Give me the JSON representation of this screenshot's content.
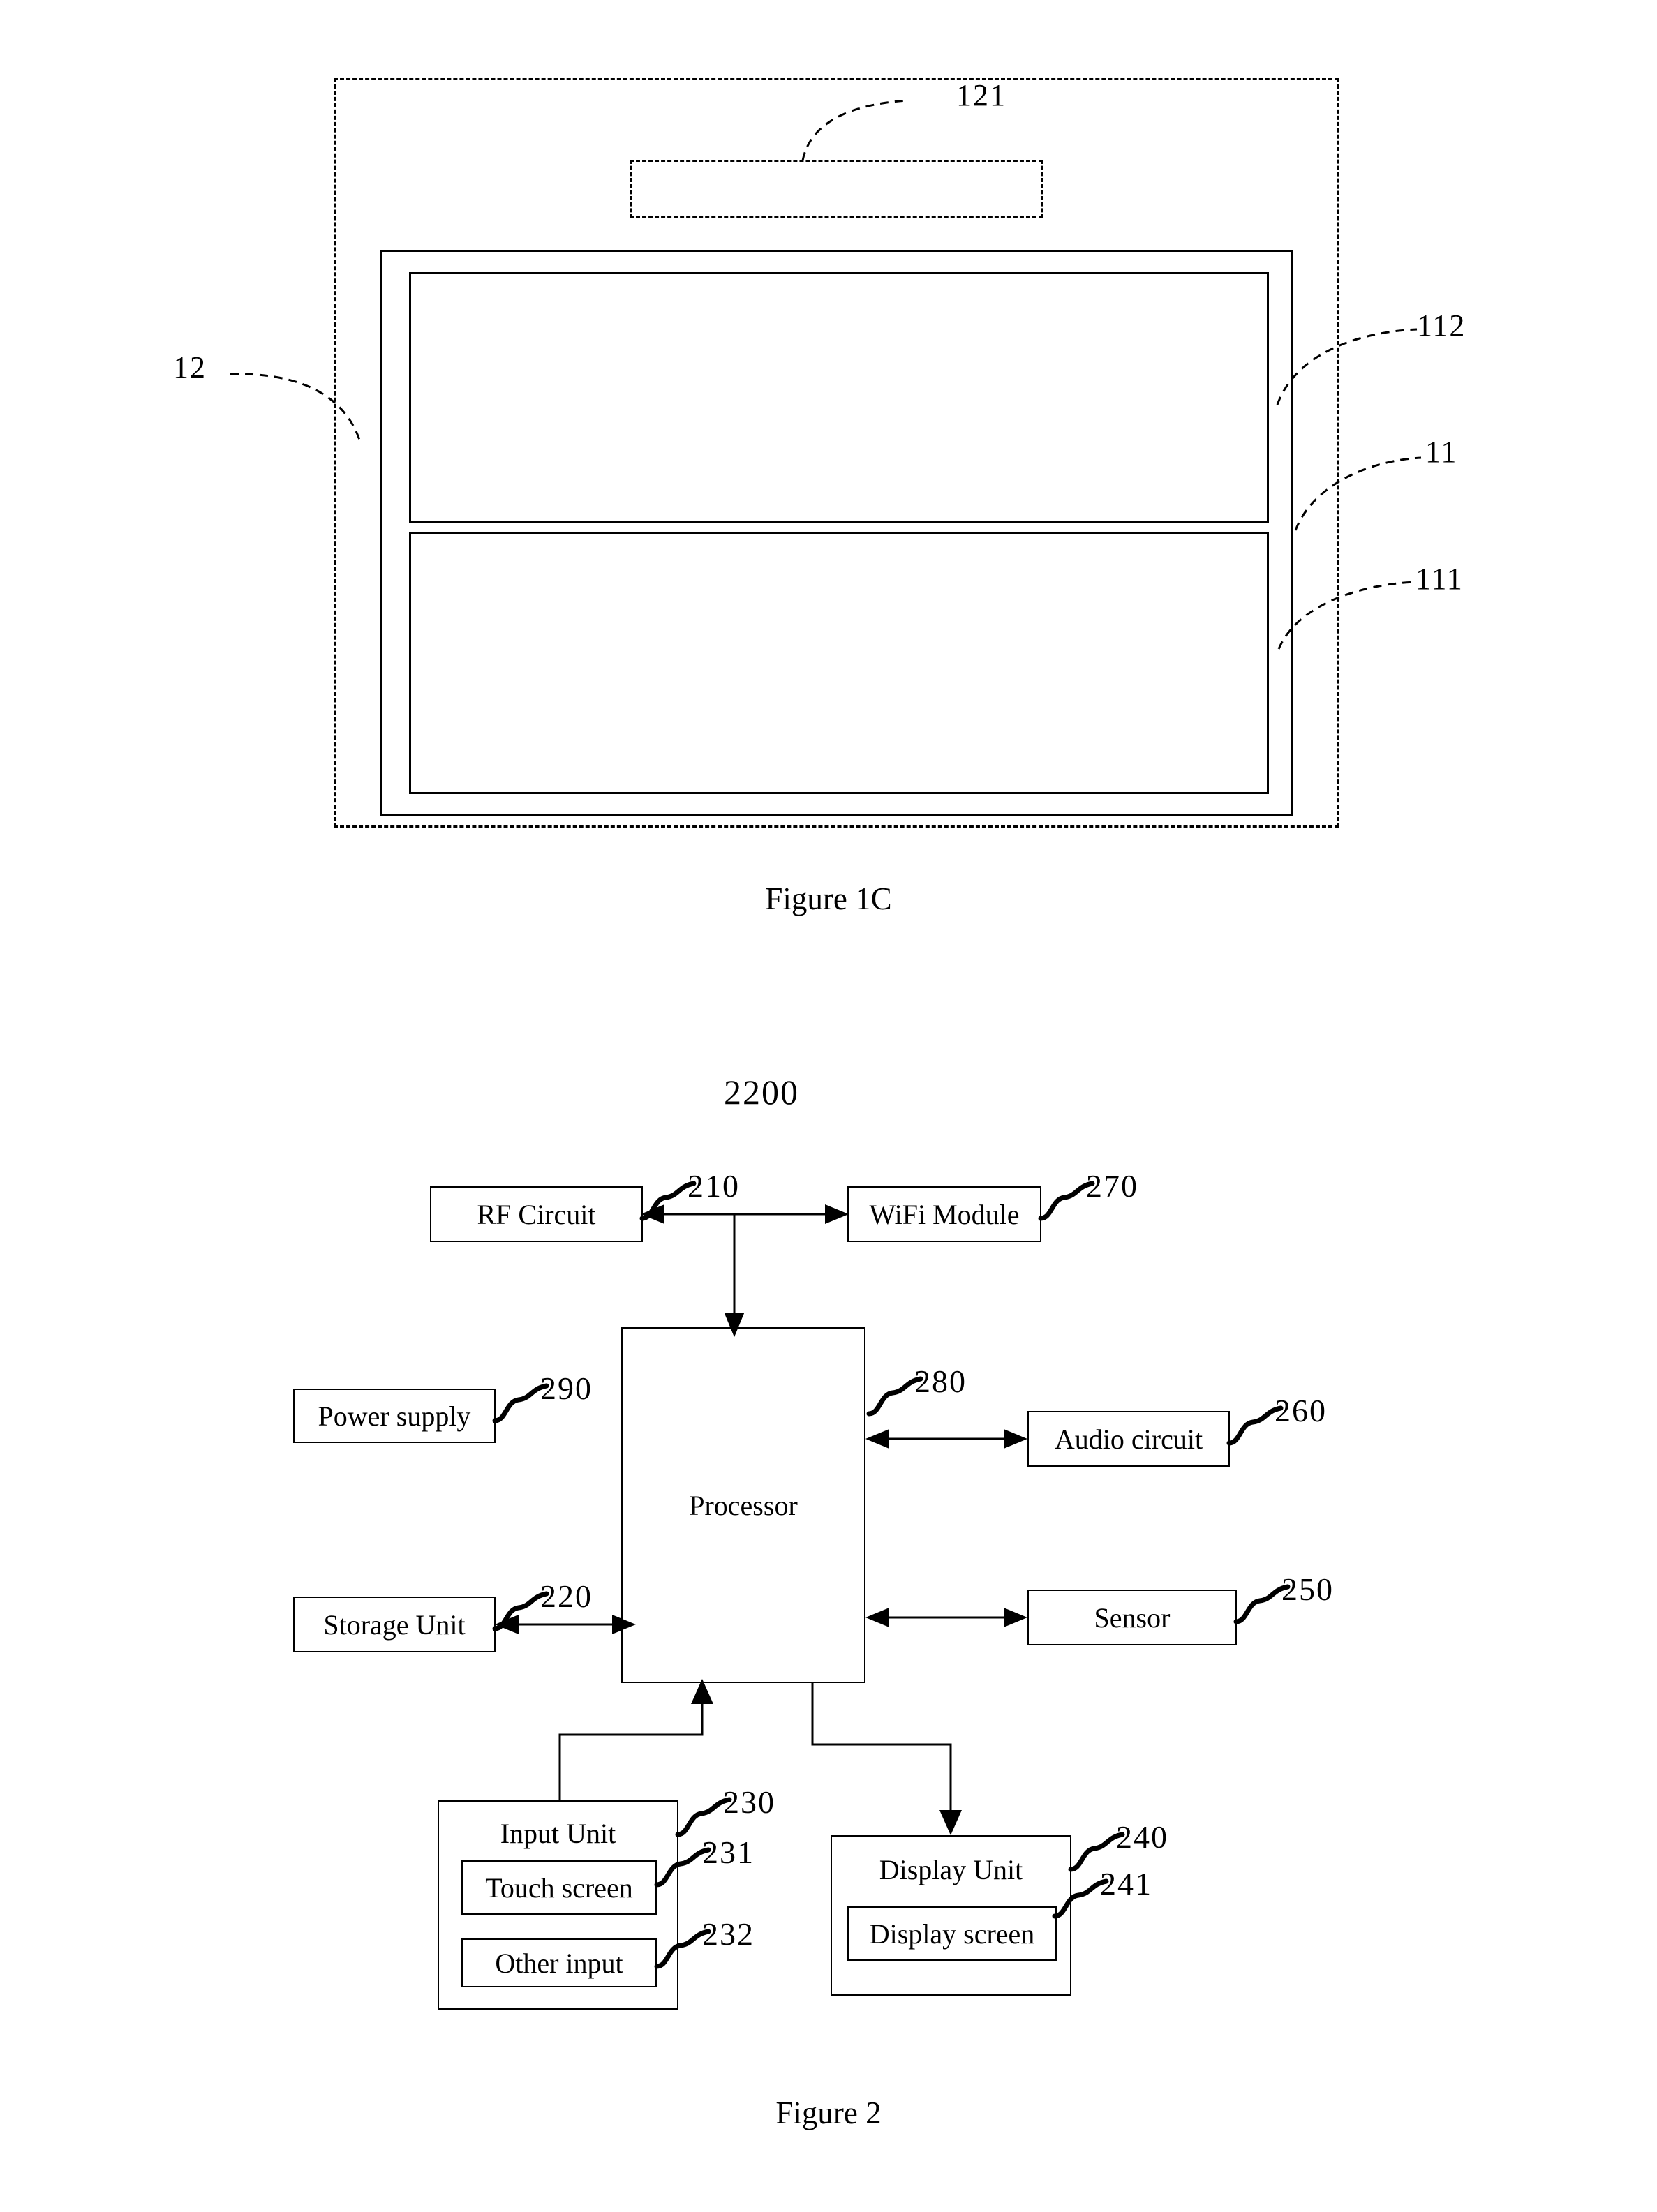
{
  "page": {
    "figures": [
      {
        "id": "figure-1c",
        "caption": "Figure 1C",
        "reference_numerals": [
          {
            "name": "outer-housing",
            "label": "12"
          },
          {
            "name": "upper-dashed-element",
            "label": "121"
          },
          {
            "name": "display-assembly",
            "label": "11"
          },
          {
            "name": "upper-display-region",
            "label": "112"
          },
          {
            "name": "lower-display-region",
            "label": "111"
          }
        ]
      },
      {
        "id": "figure-2",
        "caption": "Figure 2",
        "device_label": "2200",
        "blocks": [
          {
            "name": "rf-circuit",
            "label": "RF Circuit",
            "ref": "210"
          },
          {
            "name": "wifi-module",
            "label": "WiFi Module",
            "ref": "270"
          },
          {
            "name": "power-supply",
            "label": "Power supply",
            "ref": "290"
          },
          {
            "name": "processor",
            "label": "Processor",
            "ref": "280"
          },
          {
            "name": "audio-circuit",
            "label": "Audio circuit",
            "ref": "260"
          },
          {
            "name": "storage-unit",
            "label": "Storage Unit",
            "ref": "220"
          },
          {
            "name": "sensor",
            "label": "Sensor",
            "ref": "250"
          },
          {
            "name": "input-unit",
            "label": "Input Unit",
            "ref": "230"
          },
          {
            "name": "touch-screen",
            "label": "Touch screen",
            "ref": "231"
          },
          {
            "name": "other-input",
            "label": "Other input",
            "ref": "232"
          },
          {
            "name": "display-unit",
            "label": "Display Unit",
            "ref": "240"
          },
          {
            "name": "display-screen",
            "label": "Display screen",
            "ref": "241"
          }
        ]
      }
    ],
    "colors": {
      "ink": "#000000",
      "paper": "#ffffff"
    }
  }
}
